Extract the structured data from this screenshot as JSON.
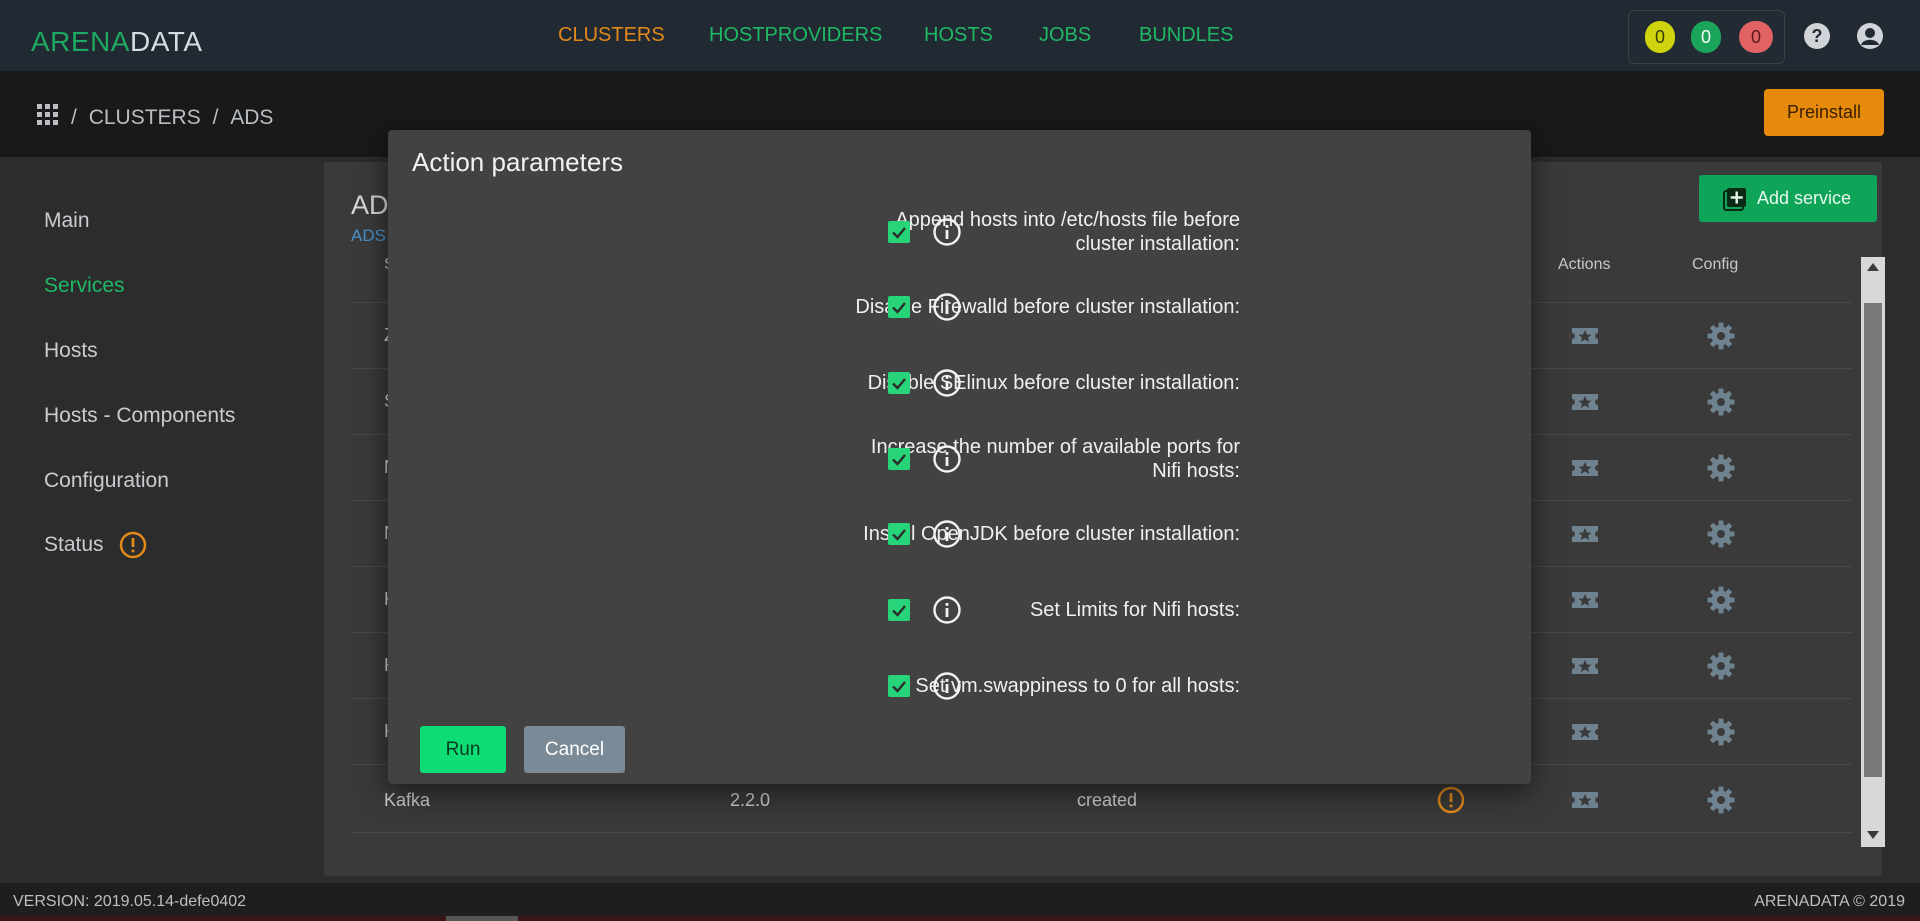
{
  "app": {
    "logo_part1": "ARENA",
    "logo_part2": "DATA"
  },
  "nav": {
    "items": [
      {
        "label": "CLUSTERS",
        "color": "#e2891a"
      },
      {
        "label": "HOSTPROVIDERS",
        "color": "#1fb865"
      },
      {
        "label": "HOSTS",
        "color": "#1fb865"
      },
      {
        "label": "JOBS",
        "color": "#1fb865"
      },
      {
        "label": "BUNDLES",
        "color": "#1fb865"
      }
    ]
  },
  "counters": {
    "yellow": "0",
    "green": "0",
    "red": "0"
  },
  "breadcrumb": {
    "sep": "/",
    "clusters": "CLUSTERS",
    "current": "ADS"
  },
  "header": {
    "preinstall_label": "Preinstall"
  },
  "sidebar": {
    "items": [
      {
        "label": "Main"
      },
      {
        "label": "Services"
      },
      {
        "label": "Hosts"
      },
      {
        "label": "Hosts - Components"
      },
      {
        "label": "Configuration"
      },
      {
        "label": "Status"
      }
    ]
  },
  "main": {
    "title_partial": "AD",
    "subtitle_partial": "ADS",
    "add_service_label": "Add service",
    "columns": {
      "s_partial": "S",
      "actions": "Actions",
      "config": "Config"
    },
    "row_initials": [
      "Z",
      "S",
      "N",
      "N",
      "K",
      "K",
      "K"
    ],
    "last_row": {
      "name": "Kafka",
      "version": "2.2.0",
      "state": "created"
    }
  },
  "modal": {
    "title": "Action parameters",
    "params": [
      {
        "line1": "Append hosts into /etc/hosts file before",
        "line2": "cluster installation:",
        "checked": true
      },
      {
        "line1": "Disable Firewalld before cluster installation:",
        "line2": "",
        "checked": true
      },
      {
        "line1": "Disable SElinux before cluster installation:",
        "line2": "",
        "checked": true
      },
      {
        "line1": "Increase the number of available ports for",
        "line2": "Nifi hosts:",
        "checked": true
      },
      {
        "line1": "Install OpenJDK before cluster installation:",
        "line2": "",
        "checked": true
      },
      {
        "line1": "Set Limits for Nifi hosts:",
        "line2": "",
        "checked": true
      },
      {
        "line1": "Set vm.swappiness to 0 for all hosts:",
        "line2": "",
        "checked": true
      }
    ],
    "run_label": "Run",
    "cancel_label": "Cancel"
  },
  "footer": {
    "version": "VERSION: 2019.05.14-defe0402",
    "copyright": "ARENADATA © 2019"
  }
}
